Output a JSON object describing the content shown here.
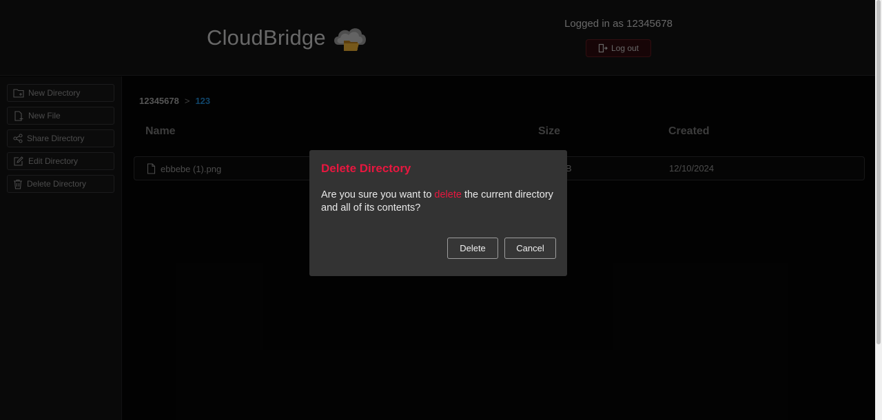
{
  "header": {
    "brand": "CloudBridge",
    "logged_in_text": "Logged in as 12345678",
    "logout_label": "Log out"
  },
  "sidebar": {
    "items": [
      {
        "label": "New Directory",
        "icon": "folder-plus-icon"
      },
      {
        "label": "New File",
        "icon": "file-plus-icon"
      },
      {
        "label": "Share Directory",
        "icon": "share-icon"
      },
      {
        "label": "Edit Directory",
        "icon": "edit-icon"
      },
      {
        "label": "Delete Directory",
        "icon": "trash-icon"
      }
    ]
  },
  "breadcrumb": {
    "root": "12345678",
    "separator": ">",
    "current": "123"
  },
  "table": {
    "headers": [
      "Name",
      "Size",
      "Created"
    ],
    "rows": [
      {
        "name": "ebbebe (1).png",
        "size": "B",
        "created": "12/10/2024"
      }
    ]
  },
  "modal": {
    "title": "Delete Directory",
    "body_before": "Are you sure you want to ",
    "body_highlight": "delete",
    "body_after": " the current directory and all of its contents?",
    "confirm_label": "Delete",
    "cancel_label": "Cancel"
  },
  "colors": {
    "danger": "#e8173f",
    "link": "#1e7fc2",
    "background": "#050505"
  }
}
